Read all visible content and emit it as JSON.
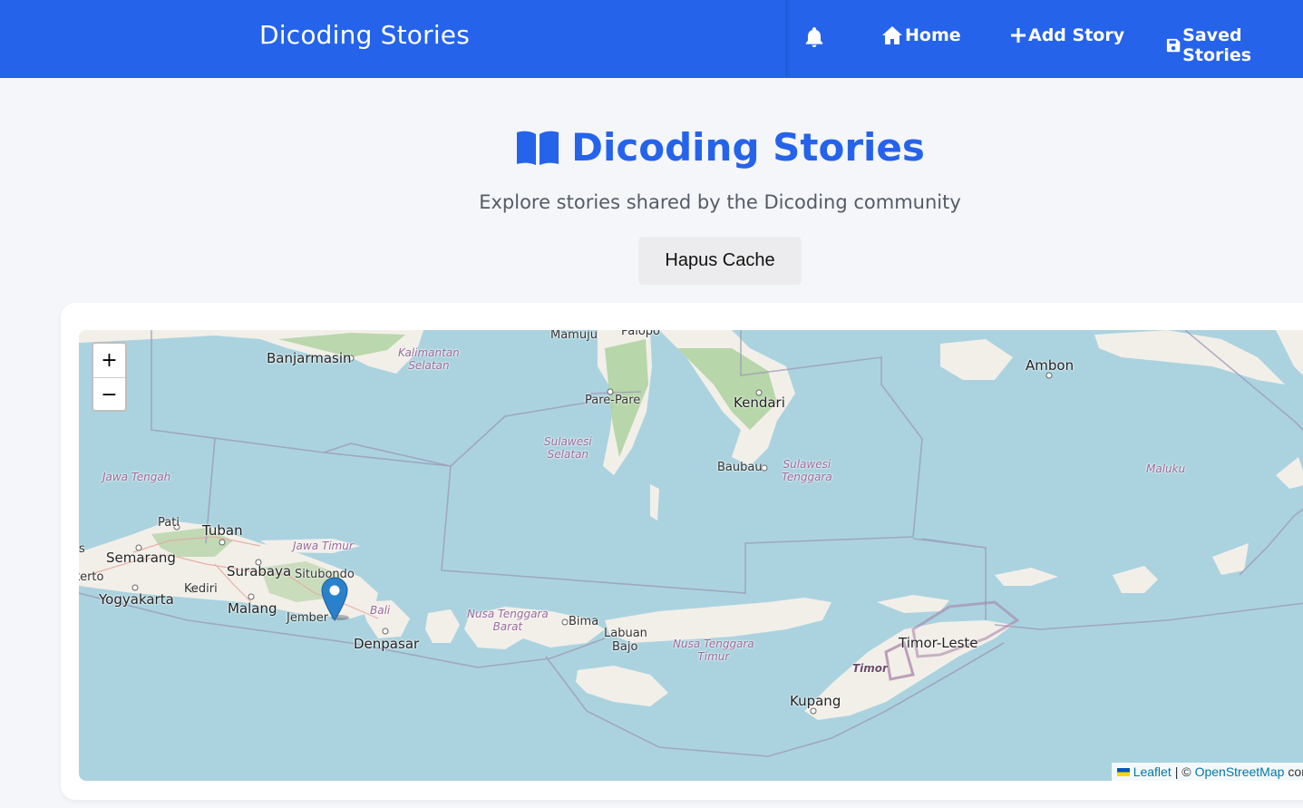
{
  "header": {
    "brand": "Dicoding Stories",
    "nav": {
      "home": "Home",
      "add_story": "Add Story",
      "saved_stories": "Saved Stories"
    }
  },
  "hero": {
    "title": "Dicoding Stories",
    "subtitle": "Explore stories shared by the Dicoding community",
    "clear_cache_label": "Hapus Cache"
  },
  "map": {
    "zoom_in": "+",
    "zoom_out": "−",
    "cities": {
      "mamuju": "Mamuju",
      "palopo": "Palopo",
      "banjarmasin": "Banjarmasin",
      "ambon": "Ambon",
      "pare_pare": "Pare-Pare",
      "kendari": "Kendari",
      "baubau": "Baubau",
      "pati": "Pati",
      "tuban": "Tuban",
      "semarang": "Semarang",
      "surabaya": "Surabaya",
      "situbondo": "Situbondo",
      "kediri": "Kediri",
      "yogyakarta": "Yogyakarta",
      "malang": "Malang",
      "jember": "Jember",
      "denpasar": "Denpasar",
      "bima": "Bima",
      "labuan_bajo_1": "Labuan",
      "labuan_bajo_2": "Bajo",
      "timor_leste": "Timor-Leste",
      "kupang": "Kupang",
      "purwokerto": "kerto",
      "edge_s": "s"
    },
    "regions": {
      "kalsel_1": "Kalimantan",
      "kalsel_2": "Selatan",
      "sulsel_1": "Sulawesi",
      "sulsel_2": "Selatan",
      "sultra_1": "Sulawesi",
      "sultra_2": "Tenggara",
      "jateng": "Jawa Tengah",
      "jatim": "Jawa Timur",
      "maluku": "Maluku",
      "bali": "Bali",
      "ntb_1": "Nusa Tenggara",
      "ntb_2": "Barat",
      "ntt_1": "Nusa Tenggara",
      "ntt_2": "Timur",
      "timor": "Timor"
    },
    "attribution": {
      "leaflet": "Leaflet",
      "separator": "| ©",
      "osm": "OpenStreetMap",
      "trail": "con"
    }
  },
  "colors": {
    "primary": "#2563eb",
    "water": "#abd3df",
    "land": "#f2efe9",
    "forest": "#add19e"
  }
}
